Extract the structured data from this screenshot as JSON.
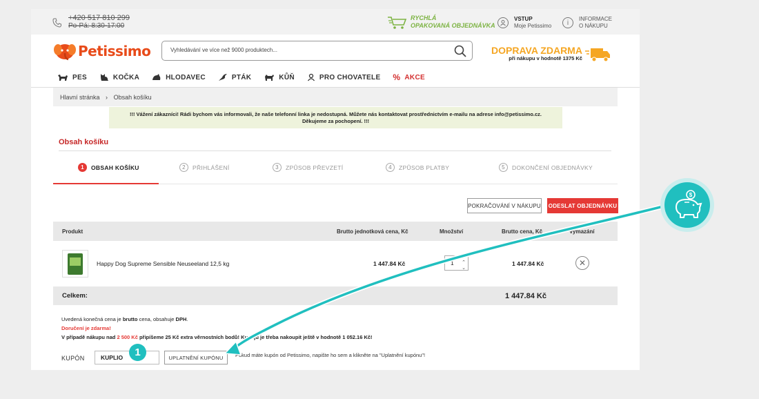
{
  "topbar": {
    "phone": "+420 517 810 299",
    "hours": "Po-Pá: 8:30-17:00",
    "fast_order_line1": "RYCHLÁ",
    "fast_order_line2": "OPAKOVANÁ OBJEDNÁVKA",
    "login_title": "VSTUP",
    "login_sub": "Moje Petissimo",
    "info_line1": "INFORMACE",
    "info_line2": "O NÁKUPU"
  },
  "header": {
    "logo_text": "Petissimo",
    "search_placeholder": "Vyhledávání ve více než 9000 produktech...",
    "free_shipping_title": "DOPRAVA ZDARMA",
    "free_shipping_sub": "při nákupu v hodnotě 1375 Kč"
  },
  "nav": {
    "items": [
      "PES",
      "KOČKA",
      "HLODAVEC",
      "PTÁK",
      "KŮŇ",
      "PRO CHOVATELE",
      "AKCE"
    ]
  },
  "breadcrumb": {
    "home": "Hlavní stránka",
    "sep": "›",
    "current": "Obsah košíku"
  },
  "notice": {
    "line1": "!!! Vážení zákazníci! Rádi bychom vás informovali, že naše telefonní linka je nedostupná. Můžete nás kontaktovat prostřednictvím e-mailu na adrese info@petissimo.cz.",
    "line2": "Děkujeme za pochopení. !!!"
  },
  "cart": {
    "title": "Obsah košíku",
    "steps": [
      {
        "num": "1",
        "label": "OBSAH KOŠÍKU"
      },
      {
        "num": "2",
        "label": "PŘIHLÁŠENÍ"
      },
      {
        "num": "3",
        "label": "ZPŮSOB PŘEVZETÍ"
      },
      {
        "num": "4",
        "label": "ZPŮSOB PLATBY"
      },
      {
        "num": "5",
        "label": "DOKONČENÍ OBJEDNÁVKY"
      }
    ],
    "continue_label": "POKRAČOVÁNÍ V NÁKUPU",
    "order_label": "ODESLAT OBJEDNÁVKU",
    "columns": {
      "product": "Produkt",
      "unit_price": "Brutto jednotková cena, Kč",
      "qty": "Množství",
      "total": "Brutto cena, Kč",
      "remove": "Vymazání"
    },
    "item": {
      "name": "Happy Dog Supreme Sensible Neuseeland 12,5 kg",
      "unit_price": "1 447.84 Kč",
      "qty": "1",
      "total": "1 447.84 Kč"
    },
    "total_label": "Celkem:",
    "total_value": "1 447.84 Kč"
  },
  "notes": {
    "n1_a": "Uvedená konečná cena je ",
    "n1_b": "brutto",
    "n1_c": " cena, obsahuje ",
    "n1_d": "DPH",
    "n1_e": ".",
    "n2": "Doručení je zdarma!",
    "n3_a": "V případě nákupu nad ",
    "n3_b": "2 500 Kč",
    "n3_c": " připíšeme 25 Kč extra věrnostních bodů! Kupuju je třeba nakoupit ještě v hodnotě 1 052.16 Kč!"
  },
  "coupon": {
    "label": "KUPÓN",
    "value": "KUPLIO",
    "button": "UPLATNĚNÍ KUPÓNU",
    "hint": "Pokud máte kupón od Petissimo, napište ho sem a klikněte na \"Uplatnění kupónu\"!"
  },
  "overlay": {
    "badge": "1",
    "accent": "#20bfbf"
  }
}
